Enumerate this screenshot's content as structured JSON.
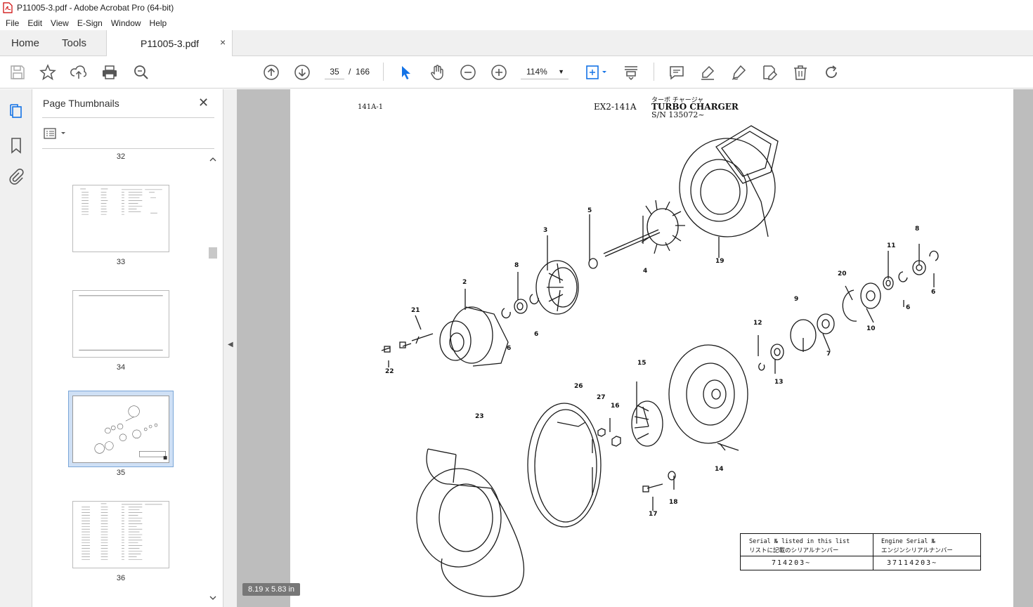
{
  "window": {
    "title": "P11005-3.pdf - Adobe Acrobat Pro (64-bit)"
  },
  "menu": [
    "File",
    "Edit",
    "View",
    "E-Sign",
    "Window",
    "Help"
  ],
  "tabs": {
    "home": "Home",
    "tools": "Tools",
    "document": "P11005-3.pdf",
    "close": "×"
  },
  "toolbar": {
    "current_page": "35",
    "page_separator": "/",
    "total_pages": "166",
    "zoom": "114%",
    "icons": [
      "save-icon",
      "bookmark-star-icon",
      "share-upload-icon",
      "print-icon",
      "find-zoom-icon",
      "prev-page-icon",
      "next-page-icon",
      "select-cursor-icon",
      "hand-icon",
      "zoom-out-icon",
      "zoom-in-icon",
      "fit-page-icon",
      "scroll-mode-icon",
      "comment-icon",
      "highlight-icon",
      "sign-icon",
      "edit-pdf-icon",
      "delete-icon",
      "rotate-icon"
    ]
  },
  "sidebar": {
    "title": "Page Thumbnails",
    "close": "✕",
    "thumbnails": [
      {
        "label": "32"
      },
      {
        "label": "33"
      },
      {
        "label": "34"
      },
      {
        "label": "35",
        "selected": true
      },
      {
        "label": "36"
      }
    ]
  },
  "document": {
    "page_size": "8.19 x 5.83 in",
    "header_left": "141A-1",
    "header_code": "EX2-141A",
    "header_jp": "ターボ チャージャ",
    "header_title": "TURBO CHARGER",
    "header_serial": "S/N 135072~",
    "part_numbers": [
      "2",
      "3",
      "4",
      "5",
      "6",
      "6",
      "6",
      "6",
      "7",
      "8",
      "8",
      "9",
      "10",
      "11",
      "12",
      "13",
      "14",
      "15",
      "16",
      "17",
      "18",
      "19",
      "20",
      "21",
      "22",
      "23",
      "26",
      "27"
    ],
    "serial_table": {
      "left_header_en": "Serial № listed in this list",
      "left_header_jp": "リストに記載のシリアルナンバー",
      "right_header_en": "Engine Serial №",
      "right_header_jp": "エンジンシリアルナンバー",
      "left_value": "714203~",
      "right_value": "37114203~"
    }
  },
  "colors": {
    "accent": "#1473e6",
    "viewport_bg": "#bdbdbd",
    "selection": "#cfe0f5"
  }
}
